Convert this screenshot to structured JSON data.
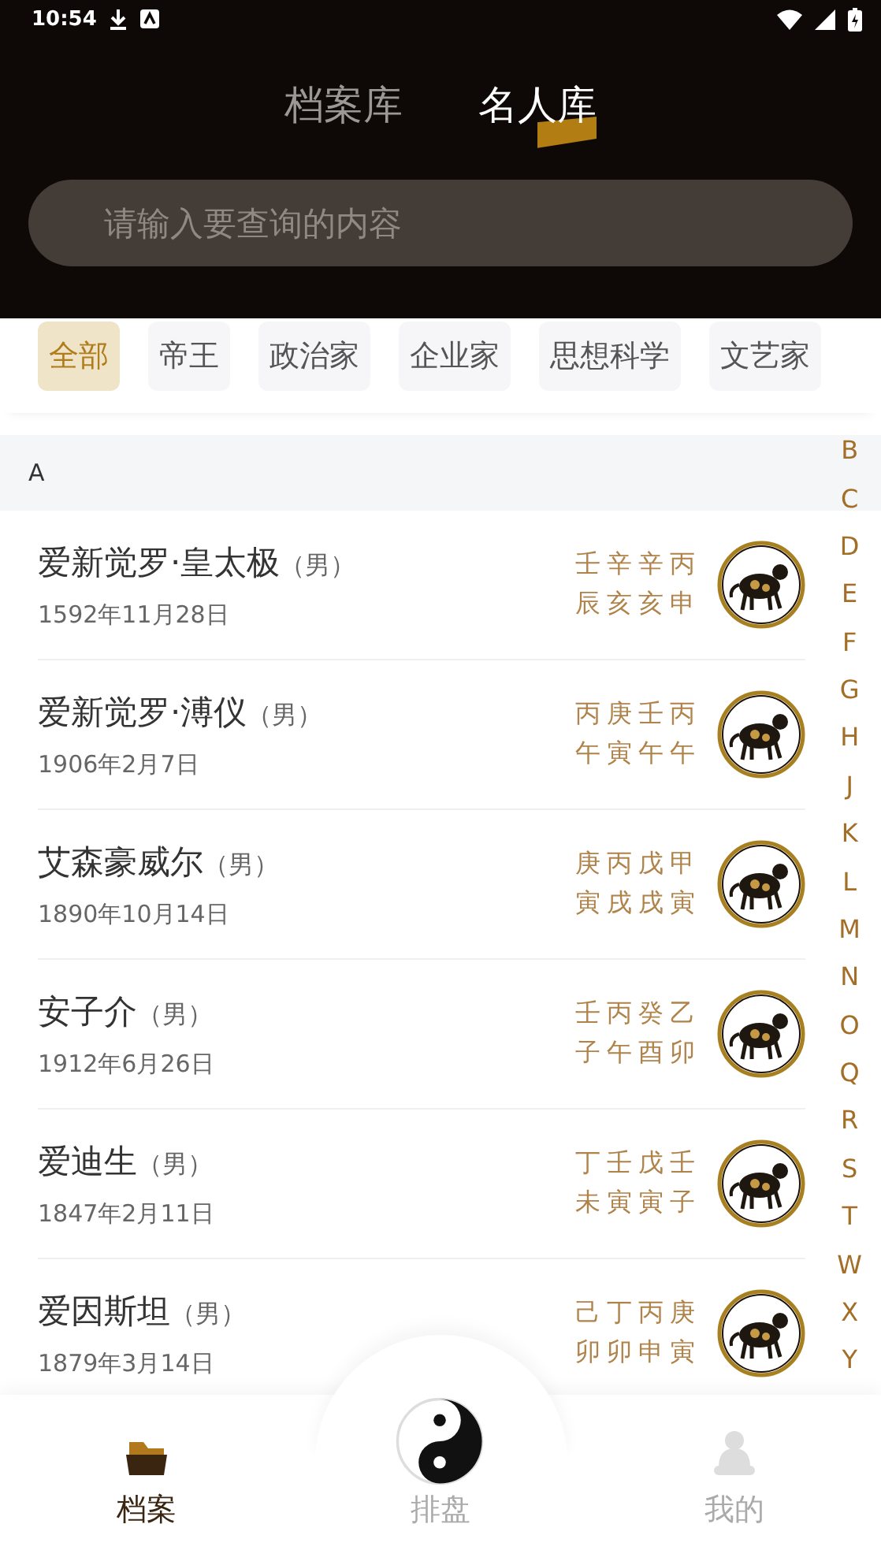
{
  "status_bar": {
    "time": "10:54"
  },
  "tabs": [
    {
      "label": "档案库",
      "selected": false
    },
    {
      "label": "名人库",
      "selected": true
    }
  ],
  "search": {
    "placeholder": "请输入要查询的内容"
  },
  "filters": [
    {
      "label": "全部",
      "selected": true
    },
    {
      "label": "帝王",
      "selected": false
    },
    {
      "label": "政治家",
      "selected": false
    },
    {
      "label": "企业家",
      "selected": false
    },
    {
      "label": "思想科学",
      "selected": false
    },
    {
      "label": "文艺家",
      "selected": false
    }
  ],
  "section": {
    "letter": "A"
  },
  "people": [
    {
      "name": "爱新觉罗·皇太极",
      "gender": "（男）",
      "date": "1592年11月28日",
      "pillars_top": "壬辛辛丙",
      "pillars_bottom": "辰亥亥申"
    },
    {
      "name": "爱新觉罗·溥仪",
      "gender": "（男）",
      "date": "1906年2月7日",
      "pillars_top": "丙庚壬丙",
      "pillars_bottom": "午寅午午"
    },
    {
      "name": "艾森豪威尔",
      "gender": "（男）",
      "date": "1890年10月14日",
      "pillars_top": "庚丙戊甲",
      "pillars_bottom": "寅戌戌寅"
    },
    {
      "name": "安子介",
      "gender": "（男）",
      "date": "1912年6月26日",
      "pillars_top": "壬丙癸乙",
      "pillars_bottom": "子午酉卯"
    },
    {
      "name": "爱迪生",
      "gender": "（男）",
      "date": "1847年2月11日",
      "pillars_top": "丁壬戊壬",
      "pillars_bottom": "未寅寅子"
    },
    {
      "name": "爱因斯坦",
      "gender": "（男）",
      "date": "1879年3月14日",
      "pillars_top": "己丁丙庚",
      "pillars_bottom": "卯卯申寅"
    }
  ],
  "index_letters": [
    "B",
    "C",
    "D",
    "E",
    "F",
    "G",
    "H",
    "J",
    "K",
    "L",
    "M",
    "N",
    "O",
    "Q",
    "R",
    "S",
    "T",
    "W",
    "X",
    "Y"
  ],
  "bottom_nav": [
    {
      "label": "档案",
      "kind": "folder",
      "selected": true
    },
    {
      "label": "排盘",
      "kind": "yinyang",
      "selected": false
    },
    {
      "label": "我的",
      "kind": "person",
      "selected": false
    }
  ]
}
